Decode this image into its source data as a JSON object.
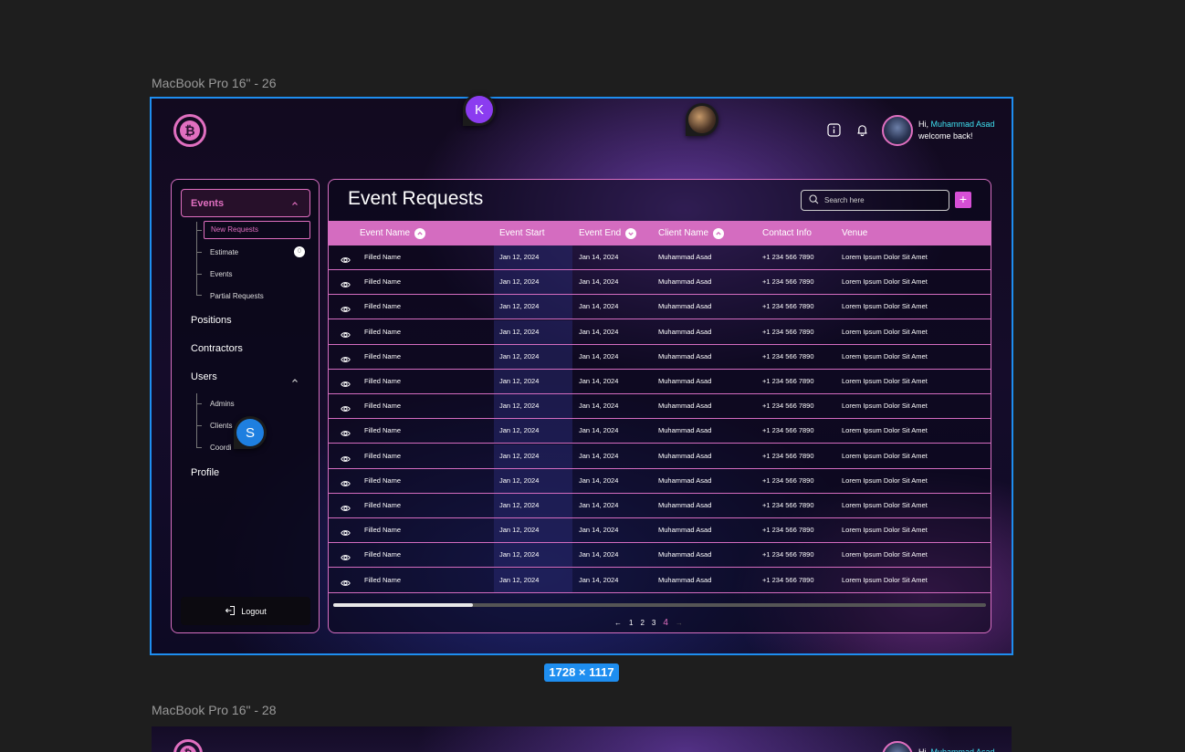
{
  "canvas": {
    "frame1_label": "MacBook Pro 16\" - 26",
    "frame2_label": "MacBook Pro 16\" - 28",
    "size_badge": "1728 × 1117"
  },
  "collaborators": {
    "k_initial": "K",
    "s_initial": "S"
  },
  "logo_symbol": "₿",
  "header": {
    "greeting_prefix": "Hi,",
    "user_name": "Muhammad Asad",
    "greeting_suffix": "welcome back!"
  },
  "sidebar": {
    "events_label": "Events",
    "events_sub": [
      {
        "label": "New Requests",
        "active": true
      },
      {
        "label": "Estimate",
        "badge": "0"
      },
      {
        "label": "Events"
      },
      {
        "label": "Partial Requests"
      }
    ],
    "positions_label": "Positions",
    "contractors_label": "Contractors",
    "users_label": "Users",
    "users_sub": [
      {
        "label": "Admins"
      },
      {
        "label": "Clients"
      },
      {
        "label": "Coordi"
      }
    ],
    "profile_label": "Profile",
    "logout_label": "Logout"
  },
  "main": {
    "title": "Event Requests",
    "search_placeholder": "Search here",
    "add_label": "+",
    "columns": [
      "Event Name",
      "Event Start",
      "Event End",
      "Client Name",
      "Contact Info",
      "Venue"
    ],
    "rows": [
      {
        "name": "Filled Name",
        "start": "Jan 12, 2024",
        "end": "Jan 14, 2024",
        "client": "Muhammad Asad",
        "contact": "+1 234 566 7890",
        "venue": "Lorem Ipsum Dolor Sit Amet"
      },
      {
        "name": "Filled Name",
        "start": "Jan 12, 2024",
        "end": "Jan 14, 2024",
        "client": "Muhammad Asad",
        "contact": "+1 234 566 7890",
        "venue": "Lorem Ipsum Dolor Sit Amet"
      },
      {
        "name": "Filled Name",
        "start": "Jan 12, 2024",
        "end": "Jan 14, 2024",
        "client": "Muhammad Asad",
        "contact": "+1 234 566 7890",
        "venue": "Lorem Ipsum Dolor Sit Amet"
      },
      {
        "name": "Filled Name",
        "start": "Jan 12, 2024",
        "end": "Jan 14, 2024",
        "client": "Muhammad Asad",
        "contact": "+1 234 566 7890",
        "venue": "Lorem Ipsum Dolor Sit Amet"
      },
      {
        "name": "Filled Name",
        "start": "Jan 12, 2024",
        "end": "Jan 14, 2024",
        "client": "Muhammad Asad",
        "contact": "+1 234 566 7890",
        "venue": "Lorem Ipsum Dolor Sit Amet"
      },
      {
        "name": "Filled Name",
        "start": "Jan 12, 2024",
        "end": "Jan 14, 2024",
        "client": "Muhammad Asad",
        "contact": "+1 234 566 7890",
        "venue": "Lorem Ipsum Dolor Sit Amet"
      },
      {
        "name": "Filled Name",
        "start": "Jan 12, 2024",
        "end": "Jan 14, 2024",
        "client": "Muhammad Asad",
        "contact": "+1 234 566 7890",
        "venue": "Lorem Ipsum Dolor Sit Amet"
      },
      {
        "name": "Filled Name",
        "start": "Jan 12, 2024",
        "end": "Jan 14, 2024",
        "client": "Muhammad Asad",
        "contact": "+1 234 566 7890",
        "venue": "Lorem Ipsum Dolor Sit Amet"
      },
      {
        "name": "Filled Name",
        "start": "Jan 12, 2024",
        "end": "Jan 14, 2024",
        "client": "Muhammad Asad",
        "contact": "+1 234 566 7890",
        "venue": "Lorem Ipsum Dolor Sit Amet"
      },
      {
        "name": "Filled Name",
        "start": "Jan 12, 2024",
        "end": "Jan 14, 2024",
        "client": "Muhammad Asad",
        "contact": "+1 234 566 7890",
        "venue": "Lorem Ipsum Dolor Sit Amet"
      },
      {
        "name": "Filled Name",
        "start": "Jan 12, 2024",
        "end": "Jan 14, 2024",
        "client": "Muhammad Asad",
        "contact": "+1 234 566 7890",
        "venue": "Lorem Ipsum Dolor Sit Amet"
      },
      {
        "name": "Filled Name",
        "start": "Jan 12, 2024",
        "end": "Jan 14, 2024",
        "client": "Muhammad Asad",
        "contact": "+1 234 566 7890",
        "venue": "Lorem Ipsum Dolor Sit Amet"
      },
      {
        "name": "Filled Name",
        "start": "Jan 12, 2024",
        "end": "Jan 14, 2024",
        "client": "Muhammad Asad",
        "contact": "+1 234 566 7890",
        "venue": "Lorem Ipsum Dolor Sit Amet"
      },
      {
        "name": "Filled Name",
        "start": "Jan 12, 2024",
        "end": "Jan 14, 2024",
        "client": "Muhammad Asad",
        "contact": "+1 234 566 7890",
        "venue": "Lorem Ipsum Dolor Sit Amet"
      }
    ],
    "pagination": {
      "prev": "←",
      "pages": [
        "1",
        "2",
        "3",
        "4"
      ],
      "current": "4",
      "next": "→"
    }
  },
  "colors": {
    "accent_pink": "#d46cc0",
    "accent_cyan": "#3fe0f0",
    "selection_blue": "#1e8ef0"
  },
  "icons": [
    "info-icon",
    "bell-icon",
    "search-icon",
    "plus-icon",
    "eye-icon",
    "chevron-up-icon",
    "chevron-down-icon",
    "logout-icon",
    "arrow-left-icon",
    "arrow-right-icon"
  ]
}
